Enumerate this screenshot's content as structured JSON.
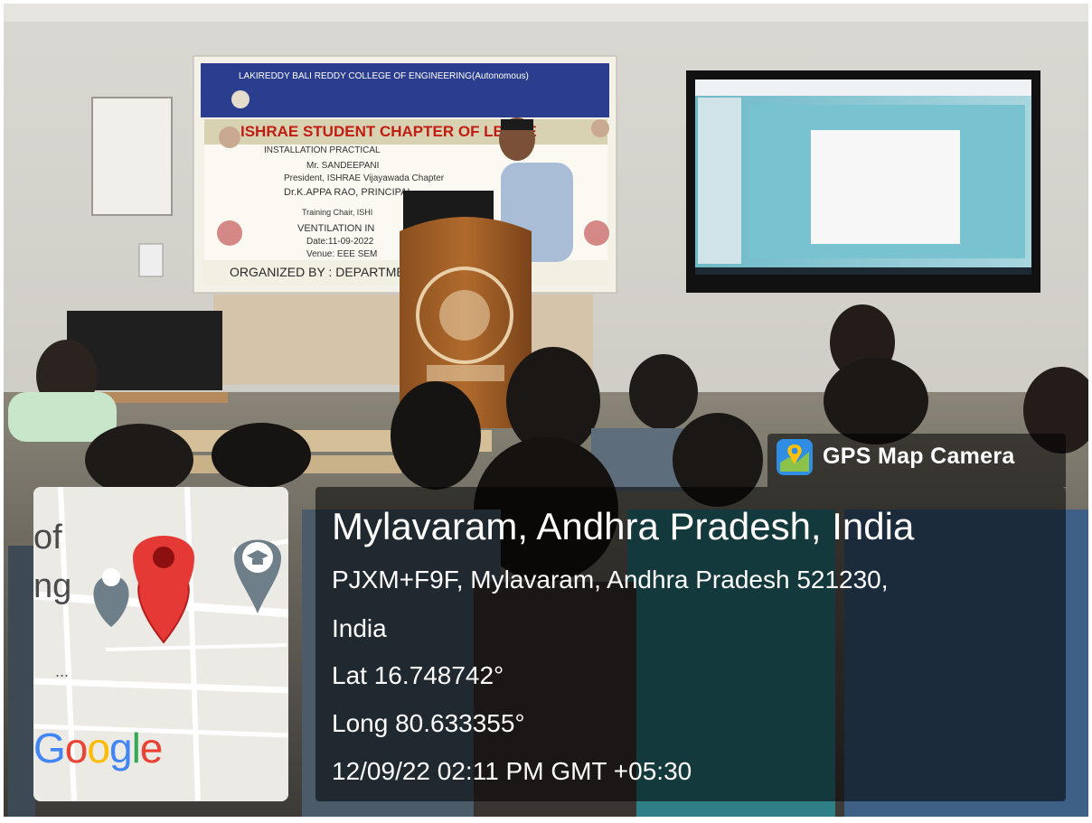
{
  "banner": {
    "college_name": "LAKIREDDY BALI REDDY COLLEGE OF ENGINEERING(Autonomous)",
    "chapter_title": "ISHRAE STUDENT CHAPTER OF LBRCE",
    "line_installation": "INSTALLATION  PRACTICAL",
    "line_speaker": "Mr. SANDEEPANI",
    "line_president": "President, ISHRAE Vijayawada Chapter",
    "line_guest": "Dr.K.APPA RAO, PRINCIPAL",
    "line_training": "Training Chair, ISHI",
    "line_ventilation": "VENTILATION IN",
    "line_date": "Date:11-09-2022",
    "line_venue": "Venue: EEE SEM",
    "line_organized": "ORGANIZED BY : DEPARTMENT  ERING"
  },
  "overlay": {
    "brand_label": "GPS Map Camera",
    "brand_icon": "gps-map-camera-icon",
    "place_title": "Mylavaram, Andhra Pradesh, India",
    "address_line1": "PJXM+F9F, Mylavaram, Andhra Pradesh 521230,",
    "address_line2": "India",
    "lat": "Lat 16.748742°",
    "long": "Long 80.633355°",
    "datetime": "12/09/22 02:11 PM GMT +05:30"
  },
  "map": {
    "partial_text_1": "of",
    "partial_text_2": "ng",
    "ellipsis": "...",
    "google_logo": "Google",
    "pin_color": "#e53935",
    "icons": [
      "location-pin-icon",
      "poi-pin-icon",
      "graduation-cap-icon"
    ]
  }
}
